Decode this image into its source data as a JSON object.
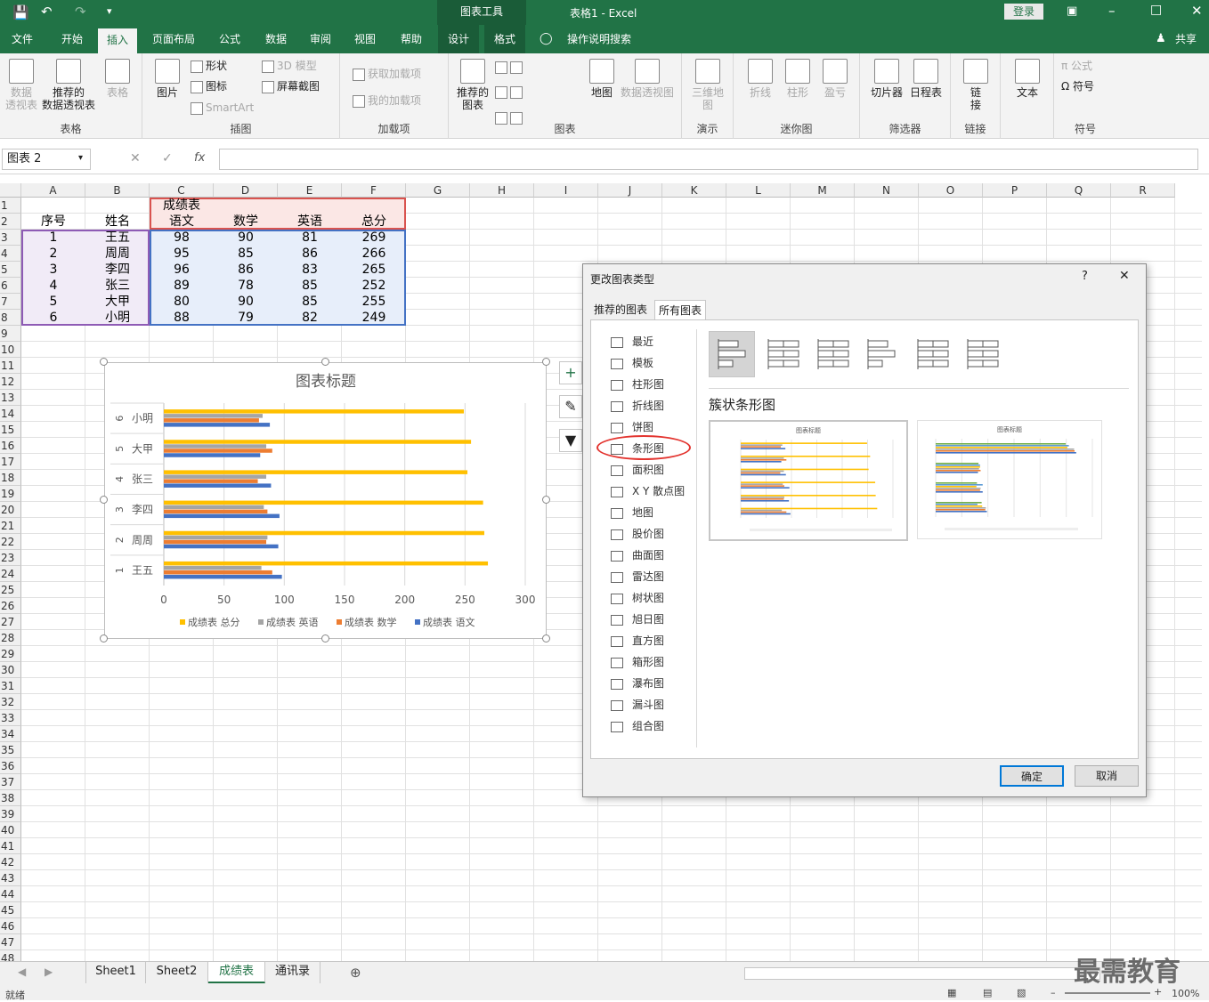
{
  "titlebar": {
    "context_tool": "图表工具",
    "doc_title": "表格1  -  Excel",
    "login": "登录"
  },
  "tabs": [
    "文件",
    "开始",
    "插入",
    "页面布局",
    "公式",
    "数据",
    "审阅",
    "视图",
    "帮助",
    "设计",
    "格式"
  ],
  "tell_me": "操作说明搜索",
  "share": "共享",
  "ribbon": {
    "groups": {
      "table": {
        "label": "表格",
        "pivot": "数据\n透视表",
        "rec_pivot": "推荐的\n数据透视表",
        "table": "表格"
      },
      "illus": {
        "label": "插图",
        "picture": "图片",
        "shapes": "形状",
        "icons": "图标",
        "smartart": "SmartArt",
        "model3d": "3D 模型",
        "screenshot": "屏幕截图"
      },
      "addins": {
        "label": "加载项",
        "get": "获取加载项",
        "my": "我的加载项"
      },
      "charts": {
        "label": "图表",
        "rec": "推荐的\n图表",
        "map": "地图",
        "pivotchart": "数据透视图"
      },
      "tours": {
        "label": "演示",
        "map3d": "三维地\n图"
      },
      "spark": {
        "label": "迷你图",
        "line": "折线",
        "col": "柱形",
        "wl": "盈亏"
      },
      "filters": {
        "label": "筛选器",
        "slicer": "切片器",
        "timeline": "日程表"
      },
      "links": {
        "label": "链接",
        "link": "链\n接"
      },
      "text": {
        "label": "",
        "text": "文本"
      },
      "symbols": {
        "label": "符号",
        "eq": "公式",
        "sym": "符号"
      }
    }
  },
  "formula": {
    "namebox": "图表 2",
    "fx": "fx"
  },
  "columns": [
    "A",
    "B",
    "C",
    "D",
    "E",
    "F",
    "G",
    "H",
    "I",
    "J",
    "K",
    "L",
    "M",
    "N",
    "O",
    "P",
    "Q",
    "R"
  ],
  "rows": [
    "1",
    "2",
    "3",
    "4",
    "5",
    "6",
    "7",
    "8",
    "9",
    "10",
    "11",
    "12",
    "13",
    "14",
    "15",
    "16",
    "17",
    "18",
    "19",
    "20",
    "21",
    "22",
    "23",
    "24",
    "25",
    "26",
    "27",
    "28",
    "29",
    "30",
    "31",
    "32",
    "33",
    "34",
    "35",
    "36",
    "37",
    "38",
    "39",
    "40",
    "41",
    "42",
    "43",
    "44",
    "45",
    "46",
    "47",
    "48"
  ],
  "sheet": {
    "header_group": "成绩表",
    "headers": [
      "序号",
      "姓名",
      "语文",
      "数学",
      "英语",
      "总分"
    ],
    "data": [
      [
        "1",
        "王五",
        "98",
        "90",
        "81",
        "269"
      ],
      [
        "2",
        "周周",
        "95",
        "85",
        "86",
        "266"
      ],
      [
        "3",
        "李四",
        "96",
        "86",
        "83",
        "265"
      ],
      [
        "4",
        "张三",
        "89",
        "78",
        "85",
        "252"
      ],
      [
        "5",
        "大甲",
        "80",
        "90",
        "85",
        "255"
      ],
      [
        "6",
        "小明",
        "88",
        "79",
        "82",
        "249"
      ]
    ]
  },
  "chart_data": {
    "type": "bar",
    "title": "图表标题",
    "categories": [
      "1 王五",
      "2 周周",
      "3 李四",
      "4 张三",
      "5 大甲",
      "6 小明"
    ],
    "cat_num": [
      "1",
      "2",
      "3",
      "4",
      "5",
      "6"
    ],
    "cat_name": [
      "王五",
      "周周",
      "李四",
      "张三",
      "大甲",
      "小明"
    ],
    "series": [
      {
        "name": "成绩表 语文",
        "values": [
          98,
          95,
          96,
          89,
          80,
          88
        ],
        "color": "#4472c4"
      },
      {
        "name": "成绩表 数学",
        "values": [
          90,
          85,
          86,
          78,
          90,
          79
        ],
        "color": "#ed7d31"
      },
      {
        "name": "成绩表 英语",
        "values": [
          81,
          86,
          83,
          85,
          85,
          82
        ],
        "color": "#a5a5a5"
      },
      {
        "name": "成绩表 总分",
        "values": [
          269,
          266,
          265,
          252,
          255,
          249
        ],
        "color": "#ffc000"
      }
    ],
    "legend_order": [
      "成绩表 总分",
      "成绩表 英语",
      "成绩表 数学",
      "成绩表 语文"
    ],
    "xlim": [
      0,
      300
    ],
    "xticks": [
      "0",
      "50",
      "100",
      "150",
      "200",
      "250",
      "300"
    ],
    "grid": true,
    "legend": "bottom"
  },
  "dialog": {
    "title": "更改图表类型",
    "help": "?",
    "close": "✕",
    "tabs": [
      "推荐的图表",
      "所有图表"
    ],
    "types": [
      "最近",
      "模板",
      "柱形图",
      "折线图",
      "饼图",
      "条形图",
      "面积图",
      "X Y 散点图",
      "地图",
      "股价图",
      "曲面图",
      "雷达图",
      "树状图",
      "旭日图",
      "直方图",
      "箱形图",
      "瀑布图",
      "漏斗图",
      "组合图"
    ],
    "selected_type": "条形图",
    "subtype_title": "簇状条形图",
    "ok": "确定",
    "cancel": "取消"
  },
  "sheettabs": [
    "Sheet1",
    "Sheet2",
    "成绩表",
    "通讯录"
  ],
  "active_sheet": "成绩表",
  "status": {
    "ready": "就绪",
    "zoom": "100%"
  },
  "watermark": "最需教育",
  "colors": {
    "excel_green": "#217346",
    "selection_red": "#e3342f"
  }
}
